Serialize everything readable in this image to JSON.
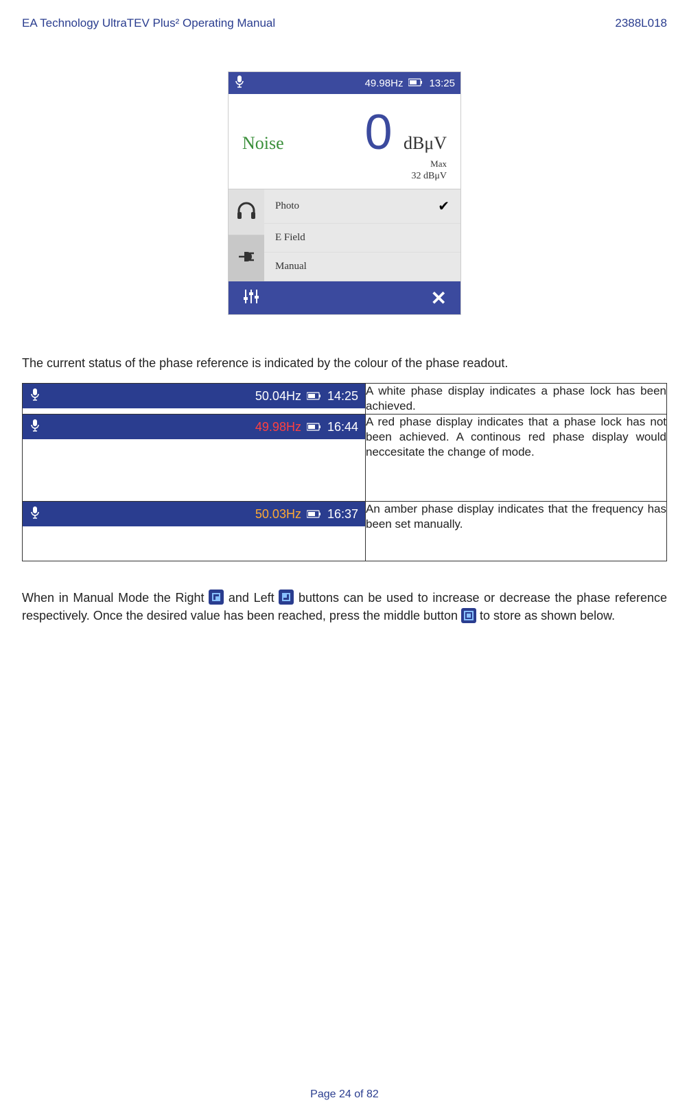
{
  "header": {
    "left": "EA Technology UltraTEV Plus² Operating Manual",
    "right": "2388L018"
  },
  "device": {
    "status": {
      "hz": "49.98Hz",
      "time": "13:25"
    },
    "main": {
      "noise_label": "Noise",
      "value": "0",
      "unit": "dBμV",
      "max_label": "Max",
      "secondary_value": "32",
      "secondary_unit": "dBμV"
    },
    "menu": {
      "photo": "Photo",
      "efield": "E Field",
      "manual": "Manual"
    }
  },
  "intro": "The current status of the phase reference is indicated by the colour of the phase readout.",
  "table": {
    "rows": [
      {
        "hz": "50.04Hz",
        "time": "14:25",
        "desc": "A white phase display indicates a phase lock has been achieved."
      },
      {
        "hz": "49.98Hz",
        "time": "16:44",
        "desc": "A red phase display indicates that a phase lock has not been achieved. A continous red phase display would neccesitate the change of mode."
      },
      {
        "hz": "50.03Hz",
        "time": "16:37",
        "desc": "An amber phase display indicates that the frequency has been set manually."
      }
    ]
  },
  "para": {
    "p1a": "When in  Manual Mode the Right ",
    "p1b": " and Left ",
    "p1c": " buttons can be used to increase or decrease the phase reference respectively. Once the desired value has been reached, press the middle button ",
    "p1d": " to store as shown below."
  },
  "footer": "Page 24 of 82"
}
